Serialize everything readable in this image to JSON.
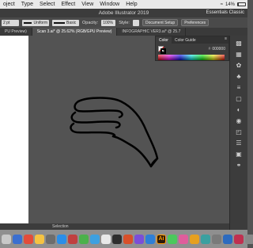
{
  "menubar": {
    "items": [
      "oject",
      "Type",
      "Select",
      "Effect",
      "View",
      "Window",
      "Help"
    ],
    "battery_percent": "14%"
  },
  "titlebar": {
    "title": "Adobe Illustrator 2019",
    "workspace": "Essentials Classic"
  },
  "controlbar": {
    "stroke_weight": "2 pt",
    "profile": "Uniform",
    "brush": "Basic",
    "opacity_label": "Opacity:",
    "opacity_value": "100%",
    "style_label": "Style:",
    "document_setup": "Document Setup",
    "preferences": "Preferences"
  },
  "tabs": [
    {
      "label": "PU Preview)",
      "active": false
    },
    {
      "label": "Scan 3.ai* @ 25.62% (RGB/GPU Preview)",
      "active": true
    },
    {
      "label": "INFOGRAPHIC VER3.ai* @ 25.7",
      "active": false
    }
  ],
  "color_panel": {
    "tab_color": "Color",
    "tab_guide": "Color Guide",
    "menu_icon": "menu-icon",
    "hex_value": "000000"
  },
  "statusbar": {
    "tool": "Selection"
  },
  "rightbar_icons": [
    "swatch-icon",
    "brush-icon",
    "symbol-icon",
    "stroke-icon",
    "gradient-icon",
    "transparency-icon",
    "appearance-icon",
    "graphic-styles-icon",
    "layers-icon",
    "artboards-icon",
    "asset-icon",
    "links-icon"
  ],
  "dock": {
    "app_ai": "Ai",
    "icon_colors": [
      "#c8c8c8",
      "#3b6fd0",
      "#e24c3a",
      "#f5c342",
      "#6d6d6d",
      "#2a8ee8",
      "#c04040",
      "#4bb14b",
      "#3da0e0",
      "#e8e8e8",
      "#2e2e2e",
      "#d8502a",
      "#7b4ed8",
      "#2f7fd6",
      "#4bc95c",
      "#e05d9c",
      "#e6a020",
      "#3aa0a0",
      "#7a7a7a",
      "#2d6bbf",
      "#c03050",
      "#888888"
    ]
  },
  "colors": {
    "canvas": "#535353",
    "panel": "#3c3c3c",
    "accent_ai": "#ff9a00"
  }
}
